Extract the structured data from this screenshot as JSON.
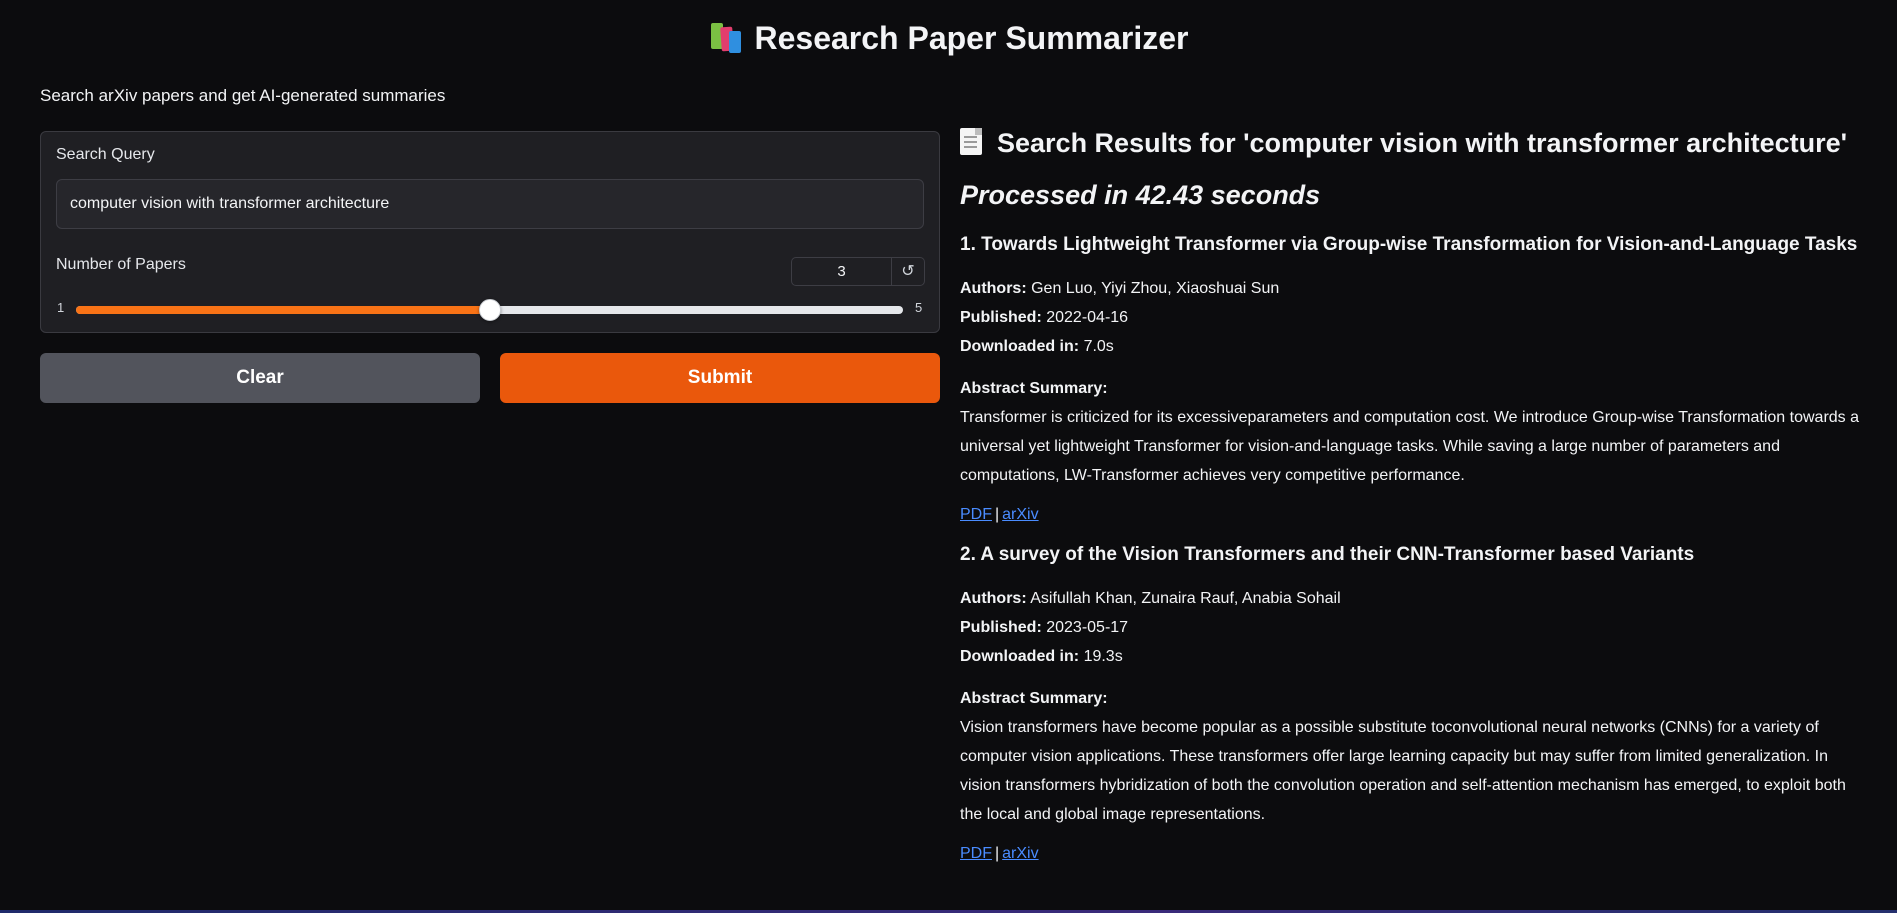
{
  "header": {
    "title": "Research Paper Summarizer",
    "title_icon": "books-icon",
    "description": "Search arXiv papers and get AI-generated summaries"
  },
  "form": {
    "query_label": "Search Query",
    "query_value": "computer vision with transformer architecture",
    "papers_label": "Number of Papers",
    "papers_value": "3",
    "slider_min": "1",
    "slider_max": "5",
    "slider_value": 3,
    "reset_icon": "↺",
    "clear_label": "Clear",
    "submit_label": "Submit"
  },
  "colors": {
    "accent": "#ea580c",
    "slider_fill": "#f97316",
    "clear_button": "#52545c",
    "link": "#4a8cff",
    "background": "#0c0c0e"
  },
  "results": {
    "title": "Search Results for 'computer vision with transformer architecture'",
    "title_icon": "document-icon",
    "processed": "Processed in 42.43 seconds",
    "labels": {
      "authors": "Authors:",
      "published": "Published:",
      "downloaded": "Downloaded in:",
      "abstract": "Abstract Summary:",
      "pdf": "PDF",
      "arxiv": "arXiv",
      "separator": "|"
    },
    "papers": [
      {
        "title": "1. Towards Lightweight Transformer via Group-wise Transformation for Vision-and-Language Tasks",
        "authors": "Gen Luo, Yiyi Zhou, Xiaoshuai Sun",
        "published": "2022-04-16",
        "downloaded": "7.0s",
        "abstract": "Transformer is criticized for its excessiveparameters and computation cost. We introduce Group-wise Transformation towards a universal yet lightweight Transformer for vision-and-language tasks. While saving a large number of parameters and computations, LW-Transformer achieves very competitive performance."
      },
      {
        "title": "2. A survey of the Vision Transformers and their CNN-Transformer based Variants",
        "authors": "Asifullah Khan, Zunaira Rauf, Anabia Sohail",
        "published": "2023-05-17",
        "downloaded": "19.3s",
        "abstract": "Vision transformers have become popular as a possible substitute toconvolutional neural networks (CNNs) for a variety of computer vision applications. These transformers offer large learning capacity but may suffer from limited generalization. In vision transformers hybridization of both the convolution operation and self-attention mechanism has emerged, to exploit both the local and global image representations."
      }
    ]
  }
}
